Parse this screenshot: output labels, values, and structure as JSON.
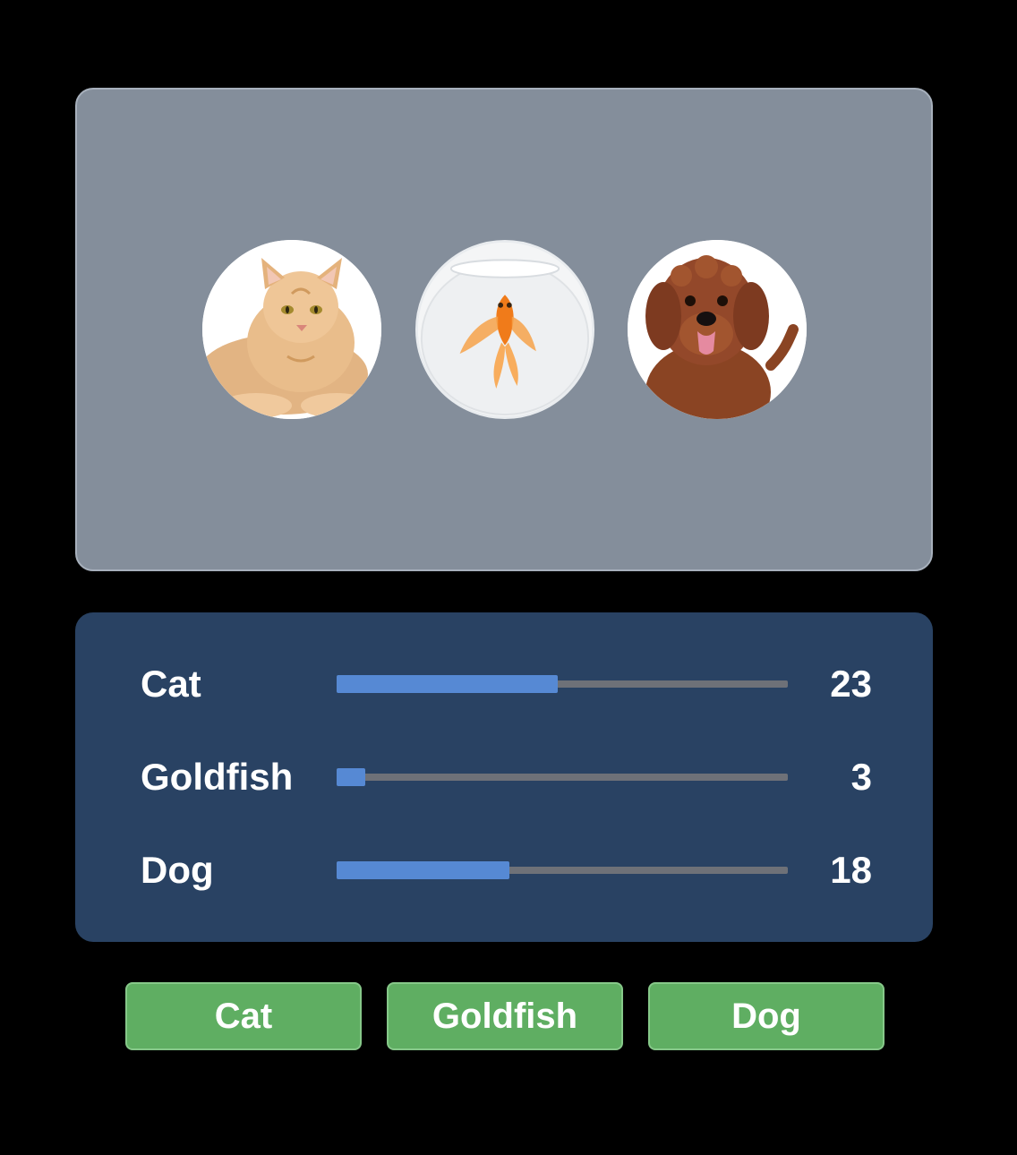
{
  "pets": [
    {
      "name": "cat",
      "image": "cat-photo"
    },
    {
      "name": "goldfish",
      "image": "goldfish-bowl-photo"
    },
    {
      "name": "dog",
      "image": "dog-photo"
    }
  ],
  "votes": {
    "max": 47,
    "rows": [
      {
        "label": "Cat",
        "count": "23",
        "value": 23
      },
      {
        "label": "Goldfish",
        "count": "3",
        "value": 3
      },
      {
        "label": "Dog",
        "count": "18",
        "value": 18
      }
    ]
  },
  "buttons": {
    "cat": "Cat",
    "goldfish": "Goldfish",
    "dog": "Dog"
  },
  "colors": {
    "background": "#000000",
    "pets_panel": "#848e9b",
    "votes_panel": "#294263",
    "bar_fill": "#5689d4",
    "bar_track": "#6e7178",
    "button": "#5fae62"
  }
}
